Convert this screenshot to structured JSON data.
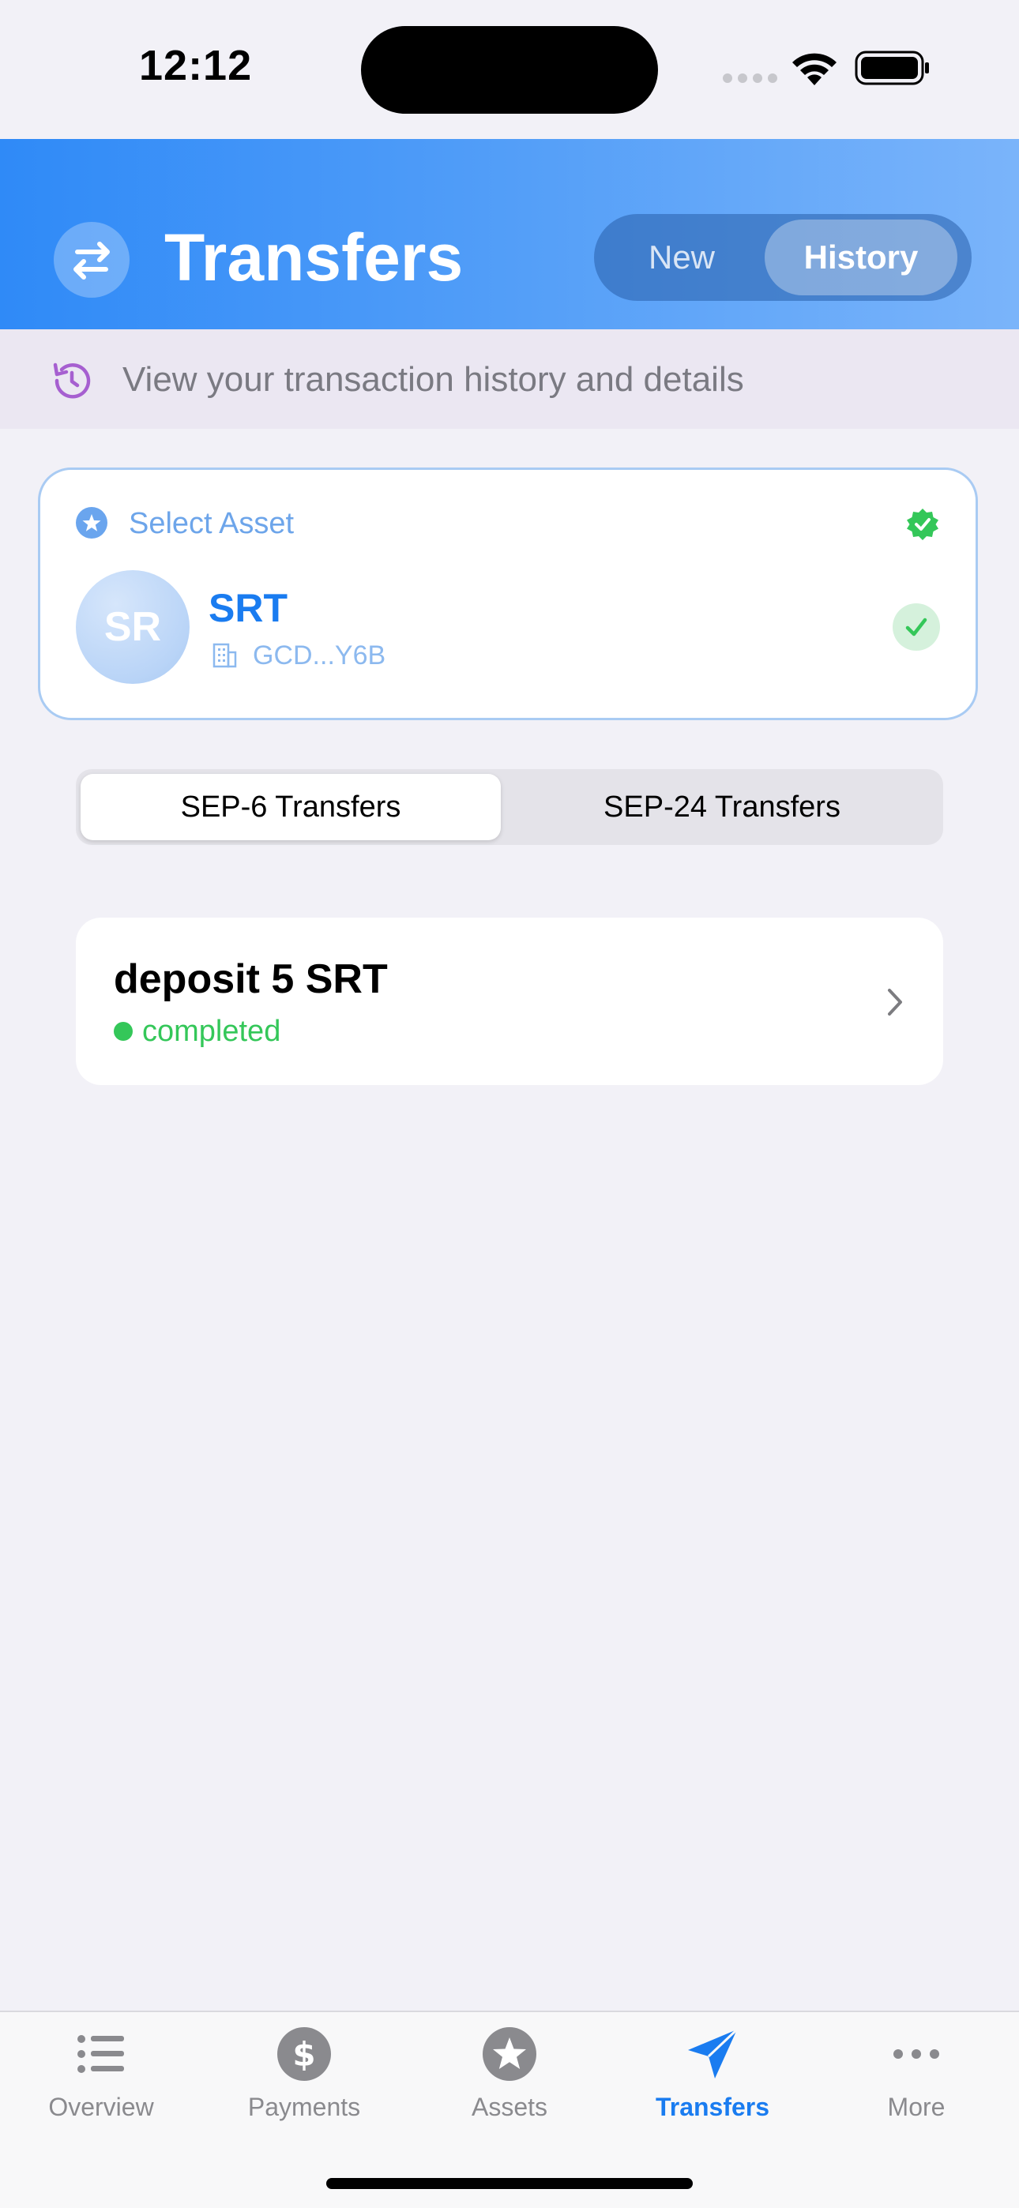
{
  "status_bar": {
    "time": "12:12"
  },
  "header": {
    "title": "Transfers",
    "segments": {
      "new": "New",
      "history": "History"
    },
    "active_segment": "History",
    "accent": "#2f8af7"
  },
  "subtitle": {
    "text": "View your transaction history and details"
  },
  "asset_card": {
    "label": "Select Asset",
    "avatar_text": "SR",
    "asset_code": "SRT",
    "issuer": "GCD...Y6B",
    "verified": true
  },
  "tabs": {
    "items": [
      "SEP-6 Transfers",
      "SEP-24 Transfers"
    ],
    "active": "SEP-6 Transfers"
  },
  "transfers": [
    {
      "title": "deposit 5 SRT",
      "status": "completed",
      "status_color": "#34c759"
    }
  ],
  "tab_bar": {
    "items": [
      {
        "label": "Overview",
        "icon": "list-icon"
      },
      {
        "label": "Payments",
        "icon": "dollar-icon"
      },
      {
        "label": "Assets",
        "icon": "star-icon"
      },
      {
        "label": "Transfers",
        "icon": "paperplane-icon"
      },
      {
        "label": "More",
        "icon": "ellipsis-icon"
      }
    ],
    "active": "Transfers",
    "active_color": "#1a7cf0"
  }
}
